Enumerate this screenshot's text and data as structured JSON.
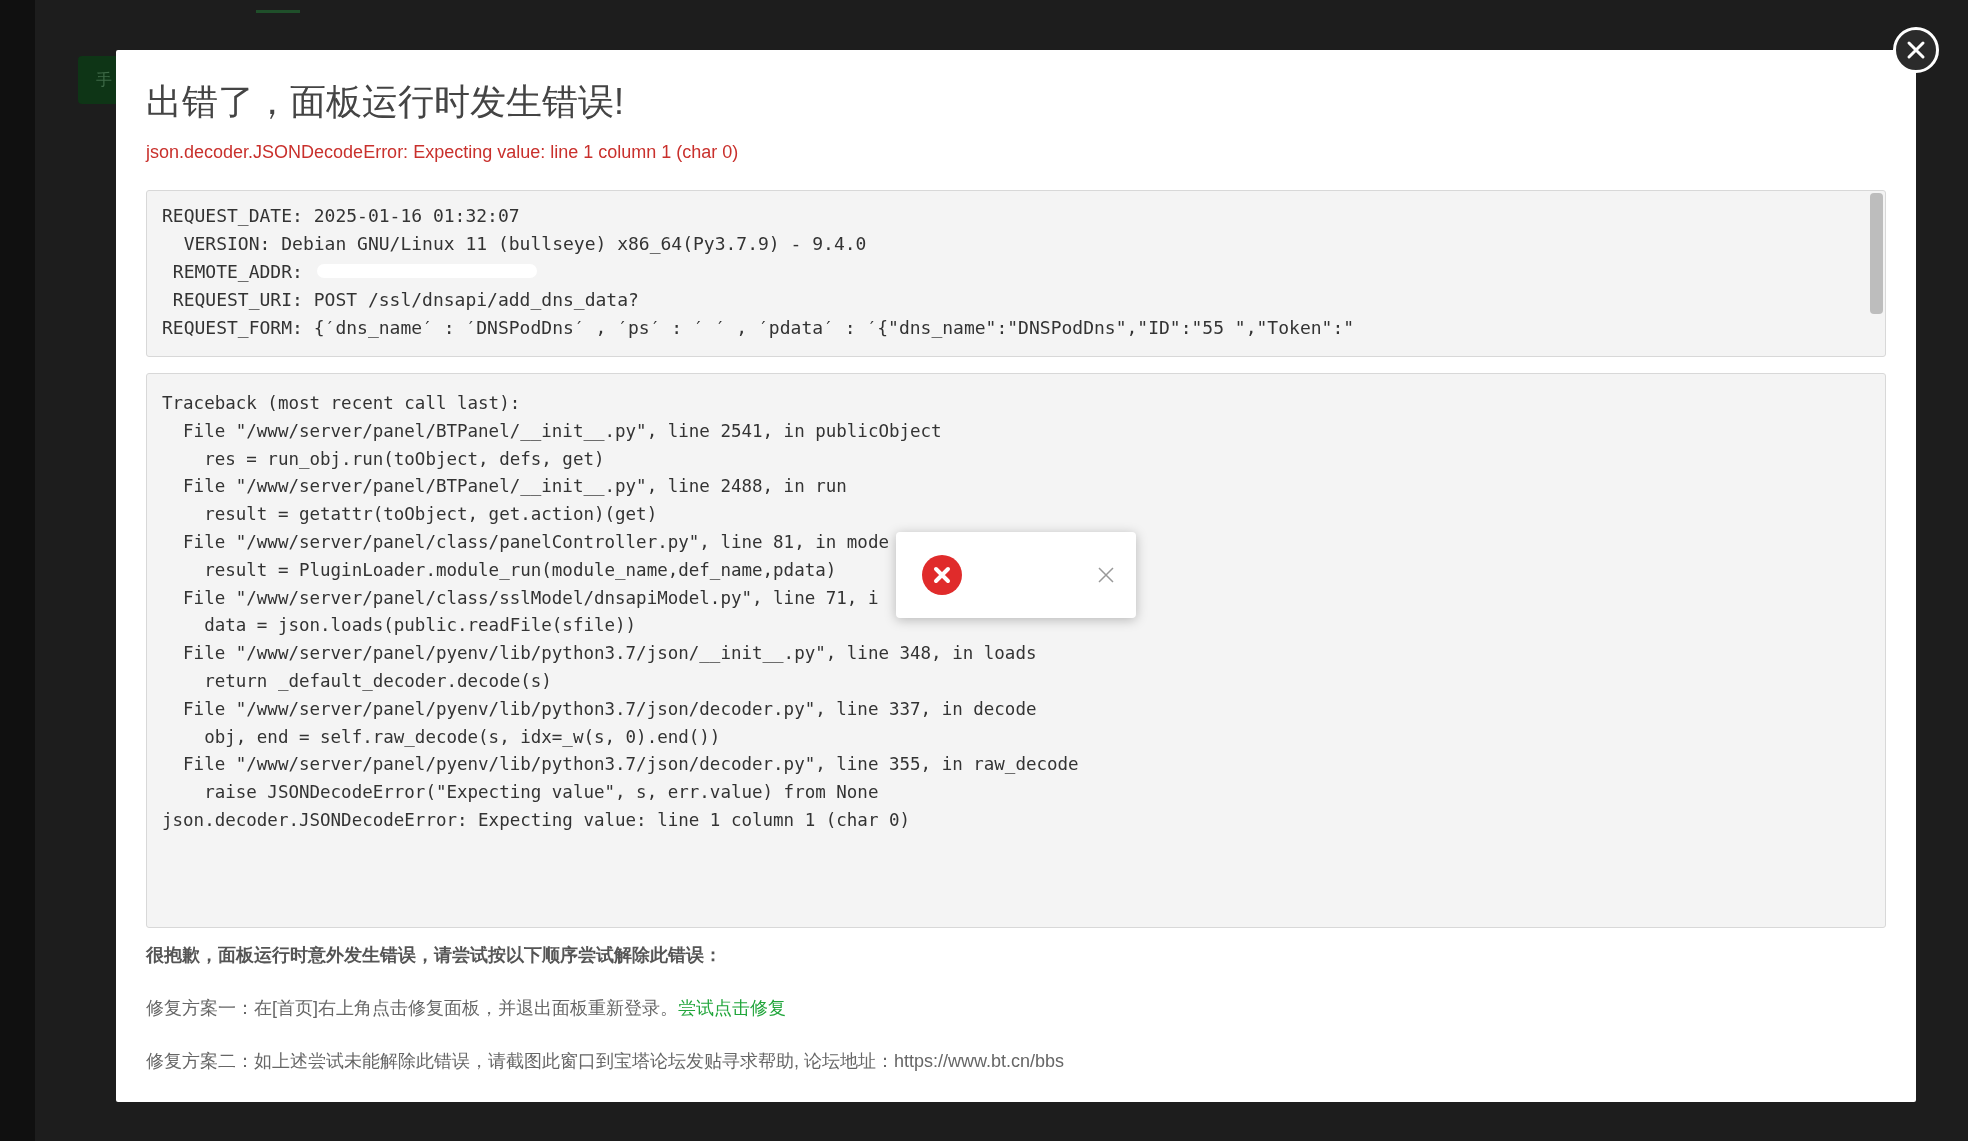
{
  "background": {
    "button_label": "手"
  },
  "dialog": {
    "title": "出错了，面板运行时发生错误!",
    "error": "json.decoder.JSONDecodeError: Expecting value: line 1 column 1 (char 0)",
    "request_lines": [
      "REQUEST_DATE: 2025-01-16 01:32:07",
      "  VERSION: Debian GNU/Linux 11 (bullseye) x86_64(Py3.7.9) - 9.4.0",
      " REMOTE_ADDR:",
      " REQUEST_URI: POST /ssl/dnsapi/add_dns_data?",
      "REQUEST_FORM: {′dns_name′ : ′DNSPodDns′ , ′ps′ : ′ ′ , ′pdata′ : ′{\"dns_name\":\"DNSPodDns\",\"ID\":\"55 \",\"Token\":\""
    ],
    "traceback_lines": [
      "Traceback (most recent call last):",
      "  File \"/www/server/panel/BTPanel/__init__.py\", line 2541, in publicObject",
      "    res = run_obj.run(toObject, defs, get)",
      "  File \"/www/server/panel/BTPanel/__init__.py\", line 2488, in run",
      "    result = getattr(toObject, get.action)(get)",
      "  File \"/www/server/panel/class/panelController.py\", line 81, in mode",
      "    result = PluginLoader.module_run(module_name,def_name,pdata)",
      "  File \"/www/server/panel/class/sslModel/dnsapiModel.py\", line 71, i",
      "    data = json.loads(public.readFile(sfile))",
      "  File \"/www/server/panel/pyenv/lib/python3.7/json/__init__.py\", line 348, in loads",
      "    return _default_decoder.decode(s)",
      "  File \"/www/server/panel/pyenv/lib/python3.7/json/decoder.py\", line 337, in decode",
      "    obj, end = self.raw_decode(s, idx=_w(s, 0).end())",
      "  File \"/www/server/panel/pyenv/lib/python3.7/json/decoder.py\", line 355, in raw_decode",
      "    raise JSONDecodeError(\"Expecting value\", s, err.value) from None",
      "json.decoder.JSONDecodeError: Expecting value: line 1 column 1 (char 0)"
    ],
    "apology": "很抱歉，面板运行时意外发生错误，请尝试按以下顺序尝试解除此错误：",
    "fix_one": {
      "text": "修复方案一：在[首页]右上角点击修复面板，并退出面板重新登录。",
      "link": "尝试点击修复"
    },
    "fix_two": "修复方案二：如上述尝试未能解除此错误，请截图此窗口到宝塔论坛发贴寻求帮助, 论坛地址：https://www.bt.cn/bbs"
  },
  "toast": {
    "kind": "error"
  }
}
